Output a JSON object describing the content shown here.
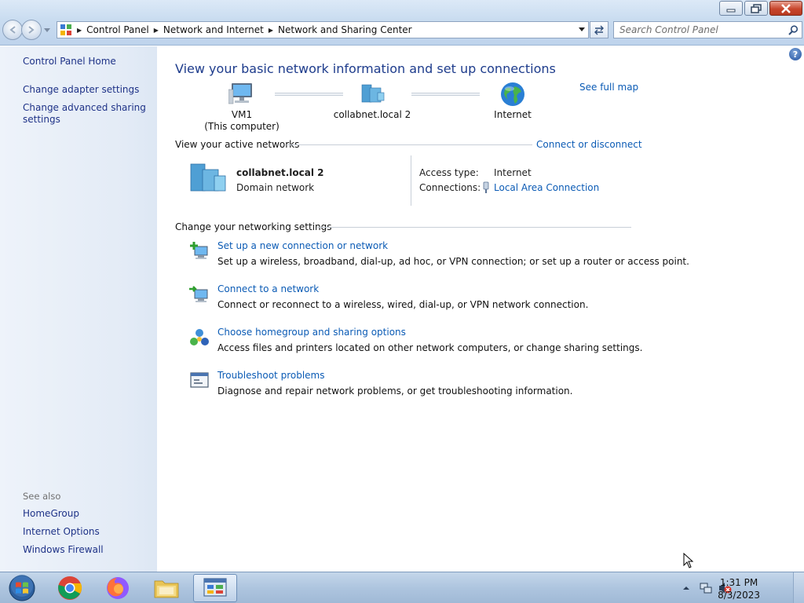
{
  "window": {
    "minimize_icon": "minimize-icon",
    "restore_icon": "restore-icon",
    "close_icon": "close-icon"
  },
  "address": {
    "crumbs": [
      "Control Panel",
      "Network and Internet",
      "Network and Sharing Center"
    ]
  },
  "search": {
    "placeholder": "Search Control Panel"
  },
  "sidebar": {
    "home": "Control Panel Home",
    "items": [
      "Change adapter settings",
      "Change advanced sharing settings"
    ],
    "see_also_title": "See also",
    "see_also": [
      "HomeGroup",
      "Internet Options",
      "Windows Firewall"
    ]
  },
  "main": {
    "heading": "View your basic network information and set up connections",
    "see_full_map": "See full map",
    "map": {
      "computer_name": "VM1",
      "computer_sub": "(This computer)",
      "network": "collabnet.local  2",
      "internet": "Internet"
    },
    "active": {
      "title": "View your active networks",
      "connect_link": "Connect or disconnect",
      "network_name": "collabnet.local  2",
      "network_type": "Domain network",
      "access_label": "Access type:",
      "access_value": "Internet",
      "connections_label": "Connections:",
      "connections_value": "Local Area Connection"
    },
    "settings": {
      "title": "Change your networking settings",
      "tasks": [
        {
          "link": "Set up a new connection or network",
          "desc": "Set up a wireless, broadband, dial-up, ad hoc, or VPN connection; or set up a router or access point."
        },
        {
          "link": "Connect to a network",
          "desc": "Connect or reconnect to a wireless, wired, dial-up, or VPN network connection."
        },
        {
          "link": "Choose homegroup and sharing options",
          "desc": "Access files and printers located on other network computers, or change sharing settings."
        },
        {
          "link": "Troubleshoot problems",
          "desc": "Diagnose and repair network problems, or get troubleshooting information."
        }
      ]
    }
  },
  "taskbar": {
    "time": "1:31 PM",
    "date": "8/3/2023"
  },
  "colors": {
    "link": "#0b5bb5",
    "heading": "#1e3c8c",
    "sidebar_link": "#1e3287"
  }
}
